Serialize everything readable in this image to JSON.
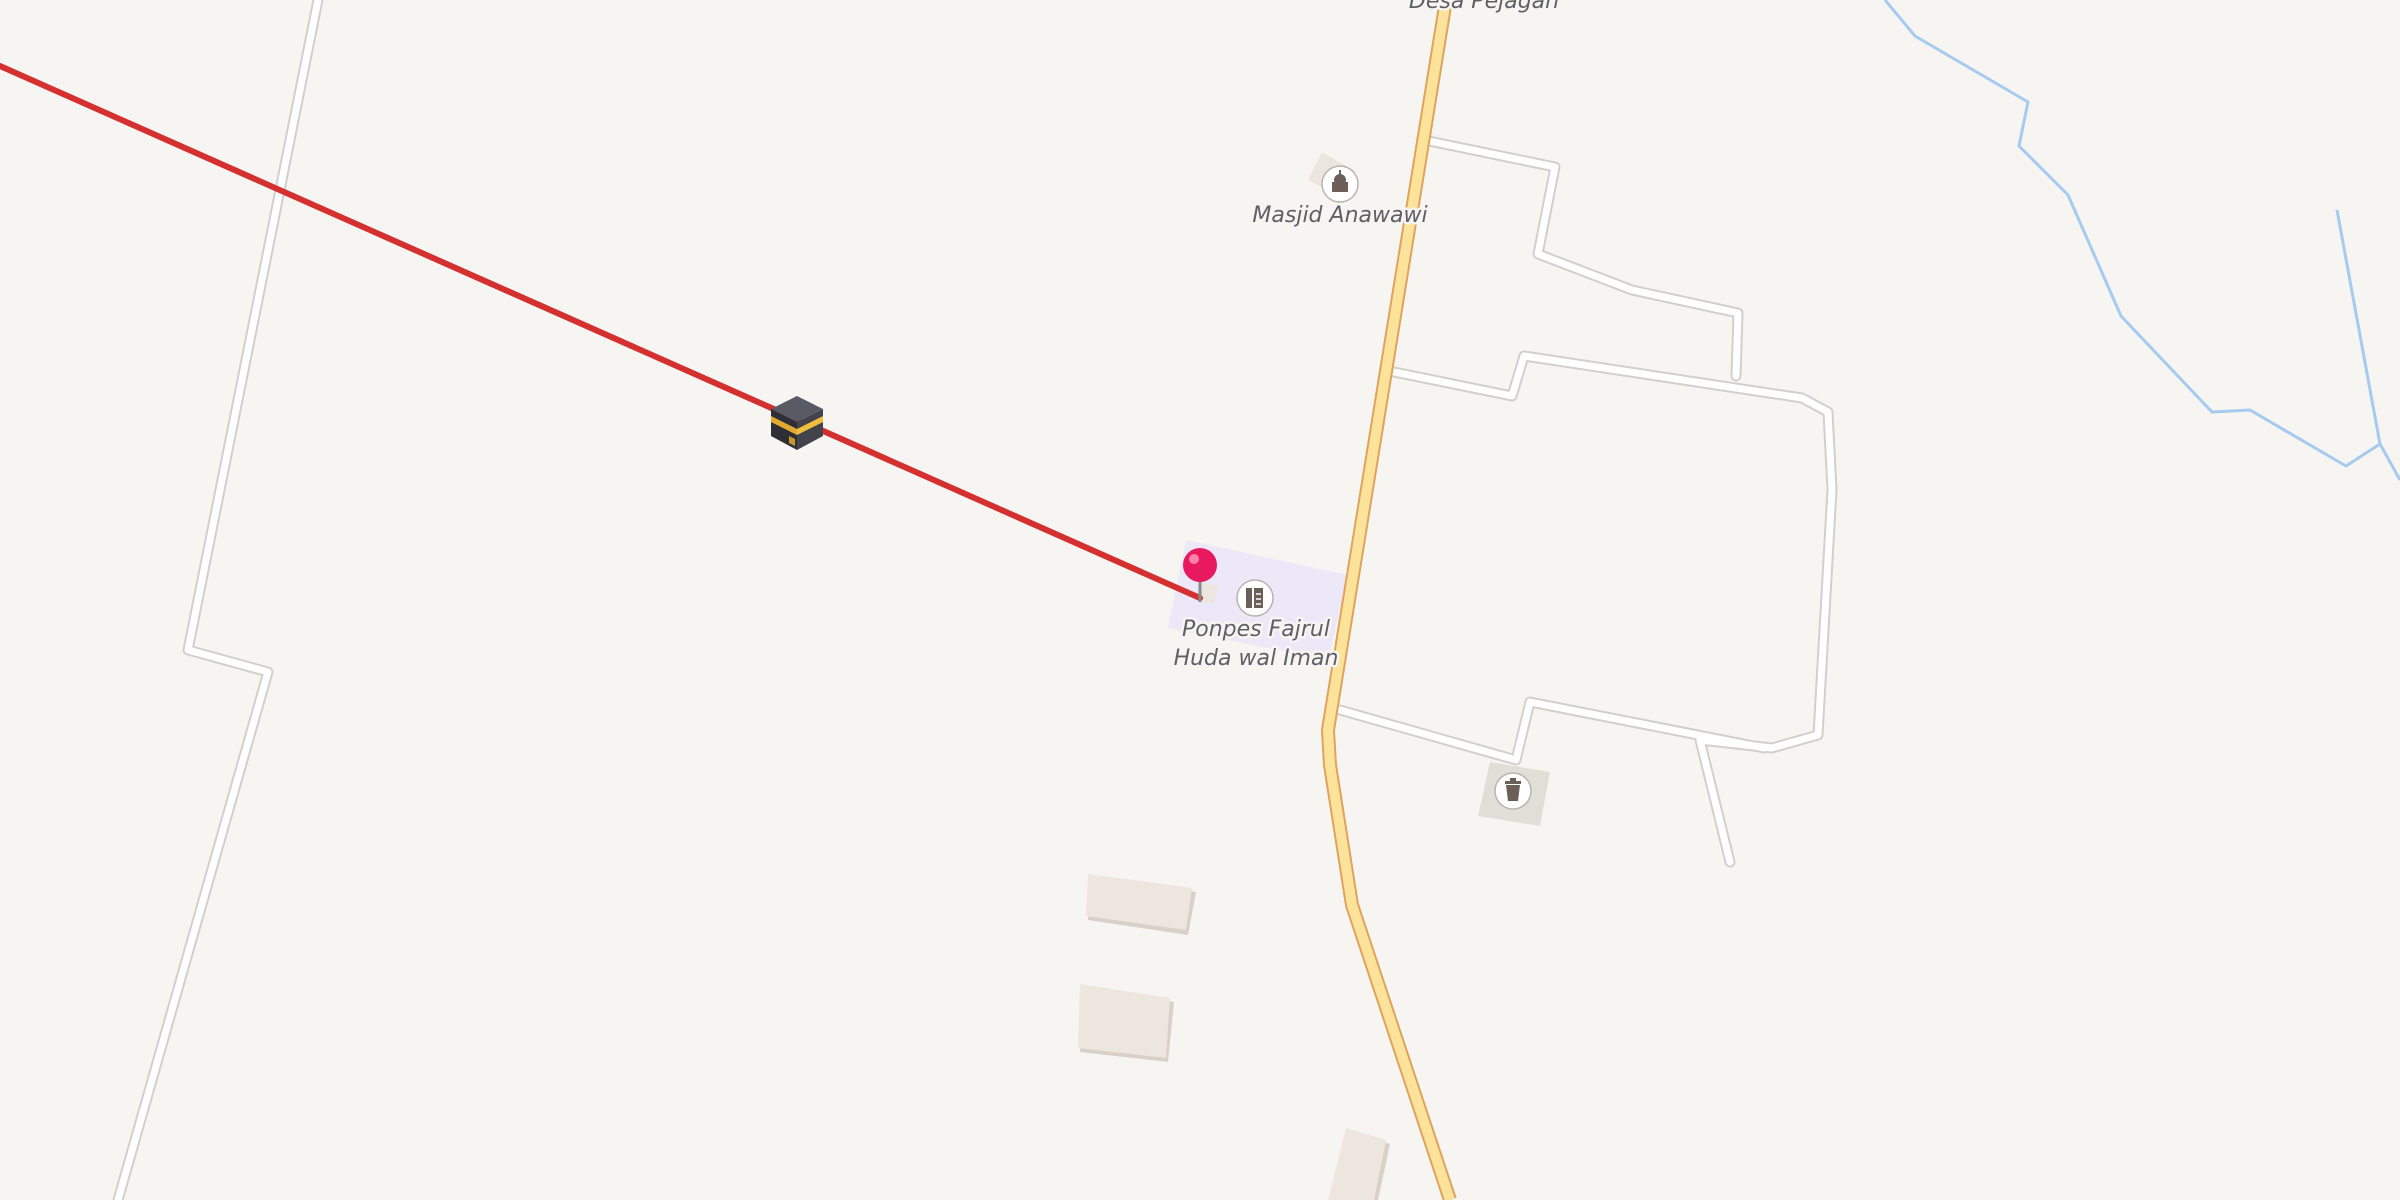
{
  "map": {
    "places": {
      "village": {
        "name": "Desa Pejagan"
      },
      "mosque": {
        "name": "Masjid Anawawi",
        "icon": "mosque-icon"
      },
      "school": {
        "line1": "Ponpes Fajrul",
        "line2": "Huda wal Iman",
        "icon": "school-icon"
      },
      "waste": {
        "icon": "waste-basket-icon"
      }
    },
    "markers": {
      "kaaba": {
        "icon": "kaaba-icon"
      },
      "pin": {
        "icon": "location-pin-icon",
        "color": "#e8195f"
      }
    },
    "colors": {
      "background": "#f7f5f2",
      "qibla_line": "#d3302f",
      "main_road_fill": "#fde39a",
      "main_road_casing": "#e0a35e",
      "minor_road": "#ffffff",
      "minor_road_casing": "#d2d0cc",
      "stream": "#a6cbef",
      "school_area": "#ece8f8",
      "building": "#ece6df"
    }
  }
}
